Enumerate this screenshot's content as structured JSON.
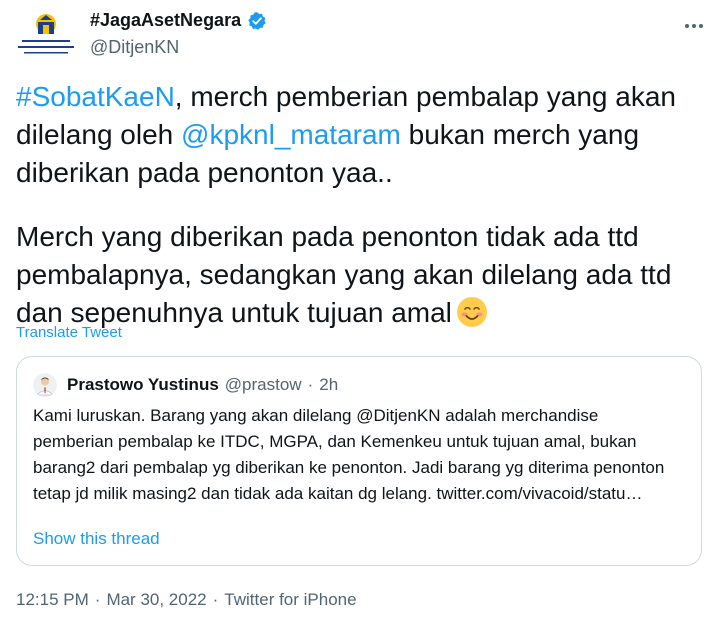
{
  "author": {
    "name": "#JagaAsetNegara",
    "handle": "@DitjenKN",
    "verified": true,
    "avatar": "ministry-of-finance-logo-icon"
  },
  "more_icon": "ellipsis-icon",
  "tweet": {
    "p1_hashtag": "#SobatKaeN",
    "p1_text_a": ", merch pemberian pembalap yang akan dilelang oleh ",
    "p1_mention": "@kpknl_mataram",
    "p1_text_b": " bukan merch yang diberikan pada penonton yaa..",
    "p2_text": "Merch yang diberikan pada penonton tidak ada ttd pembalapnya, sedangkan yang akan dilelang ada ttd dan sepenuhnya untuk tujuan amal",
    "emoji": "smiling-face-with-blush-emoji"
  },
  "translate_label": "Translate Tweet",
  "quote": {
    "name": "Prastowo Yustinus",
    "handle": "@prastow",
    "dot": "·",
    "time": "2h",
    "avatar": "person-avatar-icon",
    "body": "Kami luruskan. Barang yang akan dilelang @DitjenKN adalah merchandise pemberian pembalap ke ITDC, MGPA, dan Kemenkeu untuk tujuan amal, bukan barang2 dari pembalap yg diberikan ke penonton. Jadi barang yg diterima penonton tetap jd milik masing2 dan tidak ada kaitan dg lelang. twitter.com/vivacoid/statu…",
    "show_thread": "Show this thread"
  },
  "meta": {
    "time": "12:15 PM",
    "sep1": "·",
    "date": "Mar 30, 2022",
    "sep2": "·",
    "via": "Twitter for iPhone"
  },
  "colors": {
    "link": "#1d9bf0",
    "secondary": "#536471",
    "border": "#cfd9de",
    "text": "#0f1419"
  }
}
